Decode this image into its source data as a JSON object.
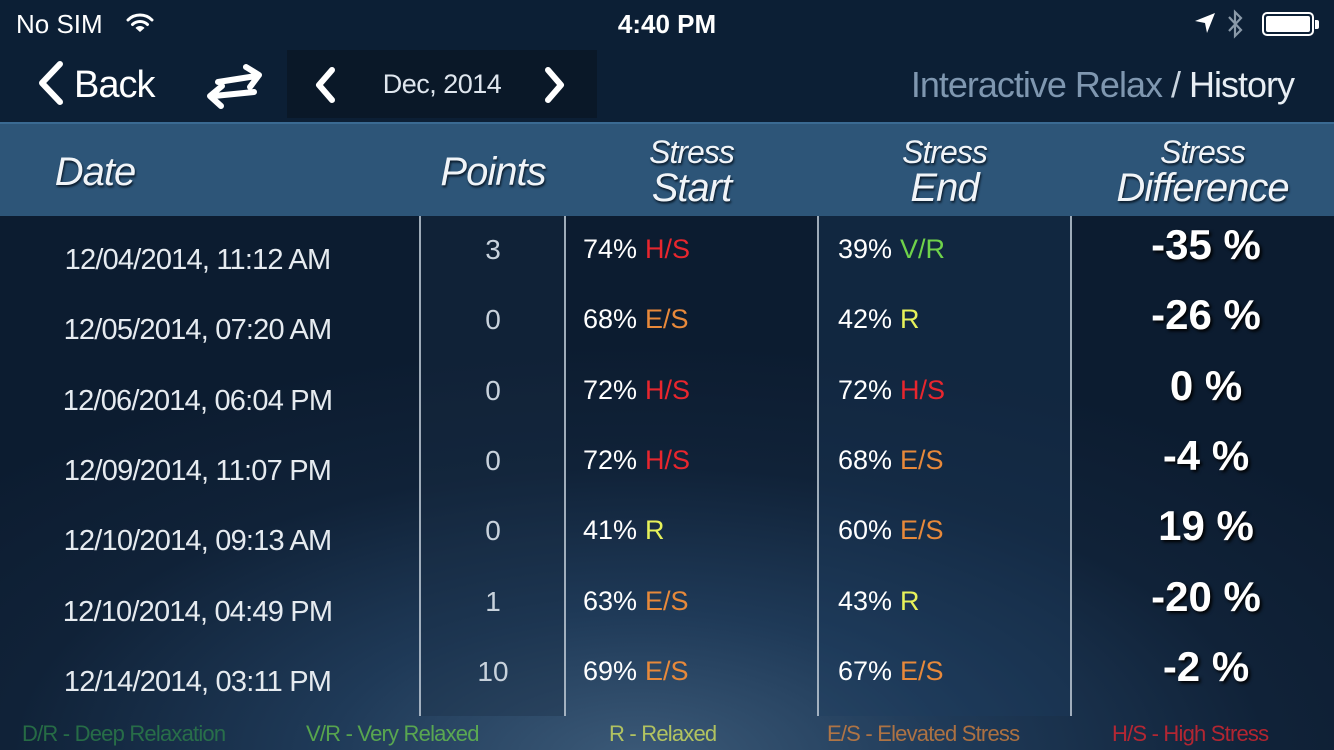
{
  "status_bar": {
    "carrier": "No SIM",
    "time": "4:40 PM",
    "icons": [
      "wifi-icon",
      "location-arrow-icon",
      "bluetooth-icon",
      "battery-icon"
    ],
    "battery_level_percent": 100
  },
  "nav": {
    "back_label": "Back",
    "swap_icon": "swap-arrows-icon",
    "month_label": "Dec, 2014",
    "prev_icon": "chevron-left-icon",
    "next_icon": "chevron-right-icon",
    "breadcrumb": {
      "app": "Interactive Relax",
      "separator": " / ",
      "page": "History"
    }
  },
  "colors": {
    "H/S": "#e8262e",
    "E/S": "#e8893a",
    "R": "#e6f25a",
    "V/R": "#6fd24a",
    "D/R": "#2f8a4a",
    "header_bg": "#2d5578",
    "topbar_bg": "#0c1f35"
  },
  "table": {
    "headers": {
      "date": "Date",
      "points": "Points",
      "stress_start": {
        "line1": "Stress",
        "line2": "Start"
      },
      "stress_end": {
        "line1": "Stress",
        "line2": "End"
      },
      "stress_diff": {
        "line1": "Stress",
        "line2": "Difference"
      }
    },
    "rows": [
      {
        "date": "12/04/2014, 11:12 AM",
        "points": "3",
        "start_pct": "74%",
        "start_lvl": "H/S",
        "end_pct": "39%",
        "end_lvl": "V/R",
        "diff": "-35 %"
      },
      {
        "date": "12/05/2014, 07:20 AM",
        "points": "0",
        "start_pct": "68%",
        "start_lvl": "E/S",
        "end_pct": "42%",
        "end_lvl": "R",
        "diff": "-26 %"
      },
      {
        "date": "12/06/2014, 06:04 PM",
        "points": "0",
        "start_pct": "72%",
        "start_lvl": "H/S",
        "end_pct": "72%",
        "end_lvl": "H/S",
        "diff": "0 %"
      },
      {
        "date": "12/09/2014, 11:07 PM",
        "points": "0",
        "start_pct": "72%",
        "start_lvl": "H/S",
        "end_pct": "68%",
        "end_lvl": "E/S",
        "diff": "-4 %"
      },
      {
        "date": "12/10/2014, 09:13 AM",
        "points": "0",
        "start_pct": "41%",
        "start_lvl": "R",
        "end_pct": "60%",
        "end_lvl": "E/S",
        "diff": "19 %"
      },
      {
        "date": "12/10/2014, 04:49 PM",
        "points": "1",
        "start_pct": "63%",
        "start_lvl": "E/S",
        "end_pct": "43%",
        "end_lvl": "R",
        "diff": "-20 %"
      },
      {
        "date": "12/14/2014, 03:11 PM",
        "points": "10",
        "start_pct": "69%",
        "start_lvl": "E/S",
        "end_pct": "67%",
        "end_lvl": "E/S",
        "diff": "-2 %"
      }
    ]
  },
  "legend": [
    {
      "code": "D/R",
      "text": "D/R - Deep Relaxation"
    },
    {
      "code": "V/R",
      "text": "V/R - Very Relaxed"
    },
    {
      "code": "R",
      "text": "R - Relaxed"
    },
    {
      "code": "E/S",
      "text": "E/S - Elevated Stress"
    },
    {
      "code": "H/S",
      "text": "H/S - High Stress"
    }
  ]
}
